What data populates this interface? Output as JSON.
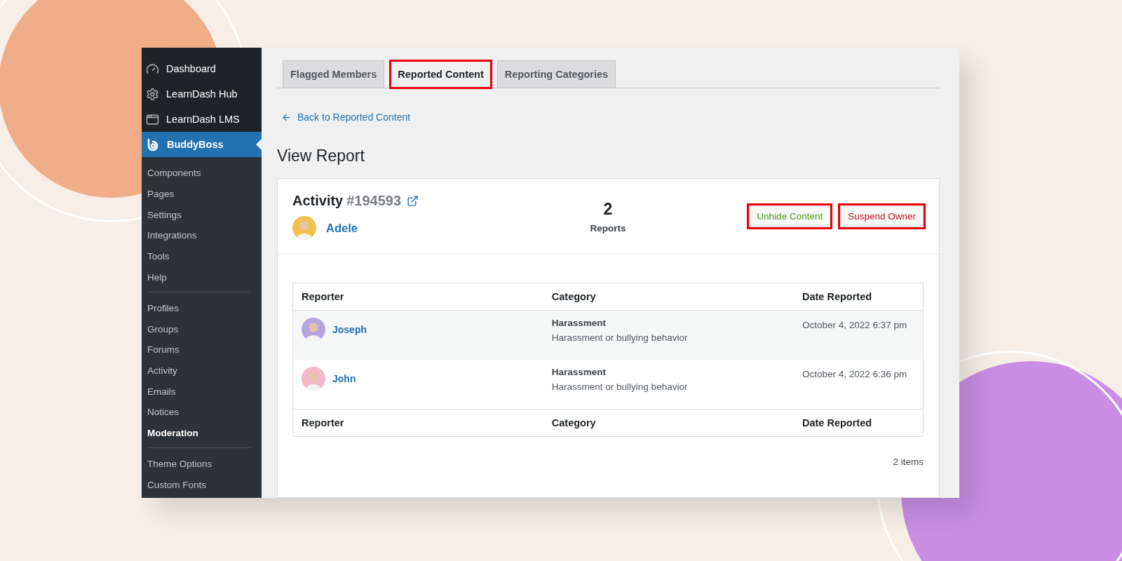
{
  "sidebar": {
    "top_items": [
      {
        "label": "Dashboard",
        "selected": false
      },
      {
        "label": "LearnDash Hub",
        "selected": false
      },
      {
        "label": "LearnDash LMS",
        "selected": false
      },
      {
        "label": "BuddyBoss",
        "selected": true
      }
    ],
    "groups": [
      [
        {
          "label": "Components",
          "selected": false
        },
        {
          "label": "Pages",
          "selected": false
        },
        {
          "label": "Settings",
          "selected": false
        },
        {
          "label": "Integrations",
          "selected": false
        },
        {
          "label": "Tools",
          "selected": false
        },
        {
          "label": "Help",
          "selected": false
        }
      ],
      [
        {
          "label": "Profiles",
          "selected": false
        },
        {
          "label": "Groups",
          "selected": false
        },
        {
          "label": "Forums",
          "selected": false
        },
        {
          "label": "Activity",
          "selected": false
        },
        {
          "label": "Emails",
          "selected": false
        },
        {
          "label": "Notices",
          "selected": false
        },
        {
          "label": "Moderation",
          "selected": true
        }
      ],
      [
        {
          "label": "Theme Options",
          "selected": false
        },
        {
          "label": "Custom Fonts",
          "selected": false
        }
      ]
    ]
  },
  "tabs": [
    {
      "label": "Flagged Members",
      "selected": false,
      "highlighted": false
    },
    {
      "label": "Reported Content",
      "selected": true,
      "highlighted": true
    },
    {
      "label": "Reporting Categories",
      "selected": false,
      "highlighted": false
    }
  ],
  "back_link": "Back to Reported Content",
  "heading": "View Report",
  "report": {
    "title": "Activity",
    "id": "#194593",
    "author": "Adele",
    "count": "2",
    "count_label": "Reports",
    "actions": [
      {
        "label": "Unhide Content",
        "kind": "unhide",
        "highlighted": true
      },
      {
        "label": "Suspend Owner",
        "kind": "suspend",
        "highlighted": true
      }
    ]
  },
  "table": {
    "columns": [
      "Reporter",
      "Category",
      "Date Reported"
    ],
    "rows": [
      {
        "reporter": "Joseph",
        "category": "Harassment",
        "description": "Harassment or bullying behavior",
        "date": "October 4, 2022 6:37 pm",
        "color": "#b9a3e0"
      },
      {
        "reporter": "John",
        "category": "Harassment",
        "description": "Harassment or bullying behavior",
        "date": "October 4, 2022 6:36 pm",
        "color": "#f2b8c8"
      }
    ],
    "footer_columns": [
      "Reporter",
      "Category",
      "Date Reported"
    ]
  },
  "item_count": "2 items"
}
